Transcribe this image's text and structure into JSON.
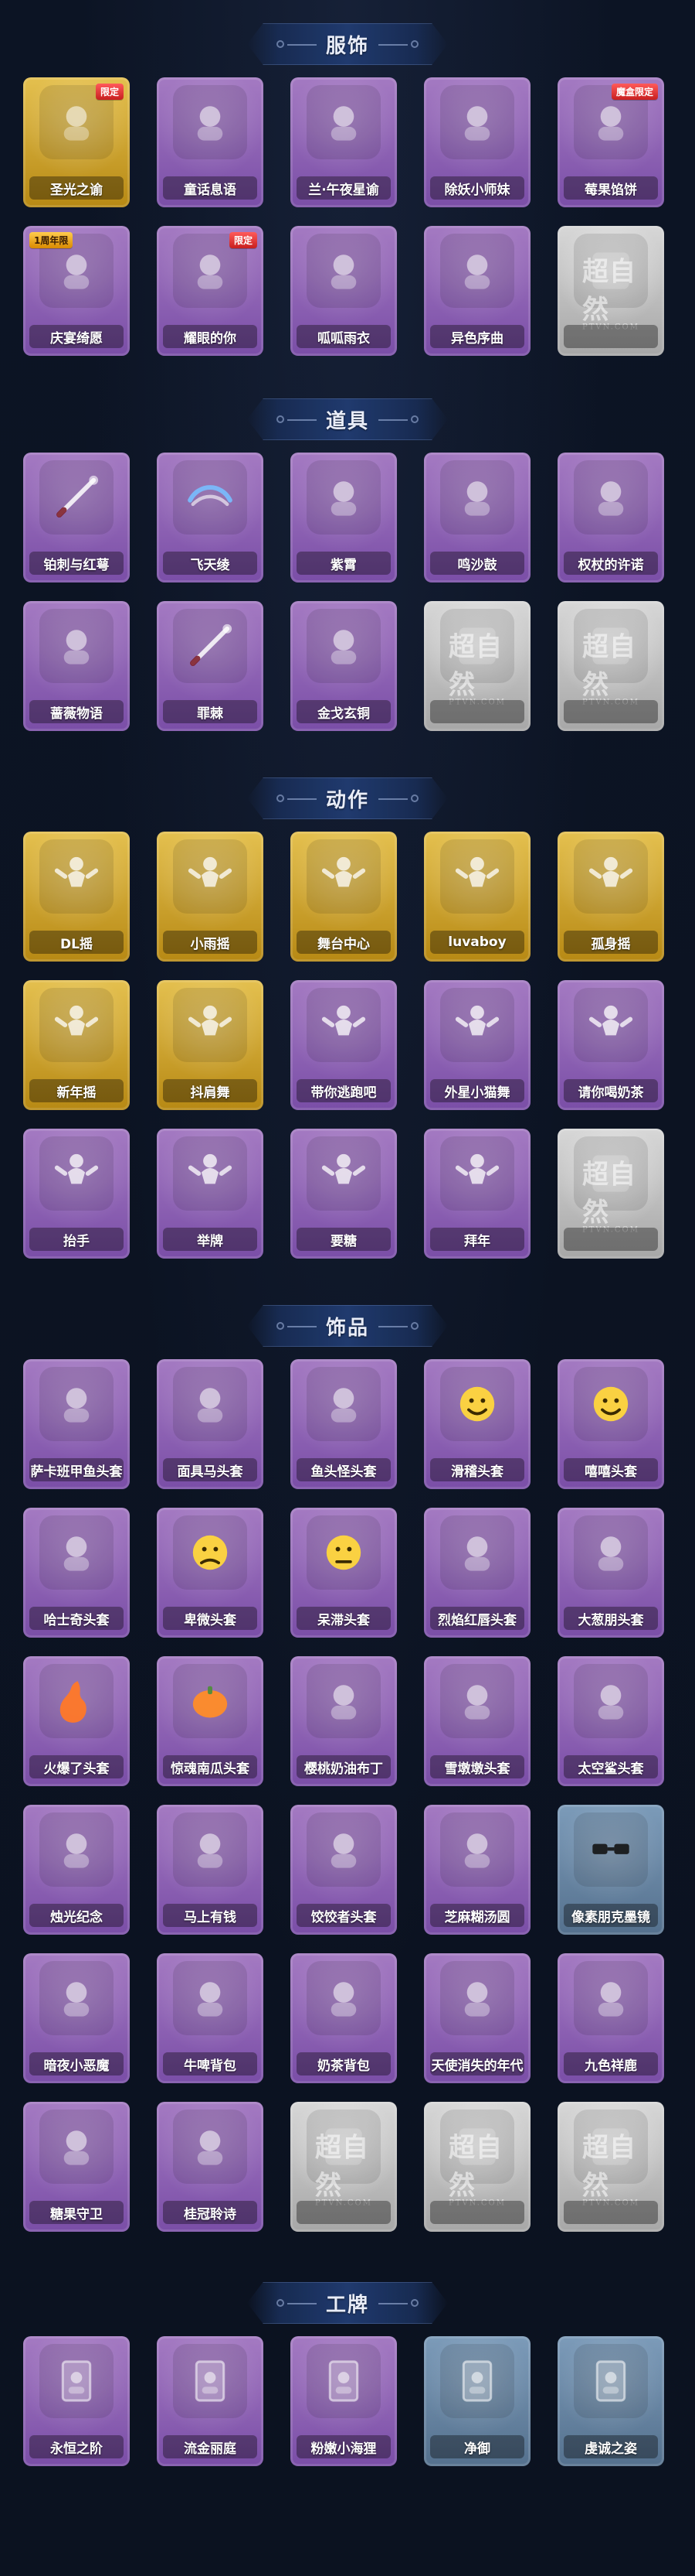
{
  "sections": [
    {
      "title": "服饰",
      "items": [
        {
          "label": "圣光之谕",
          "theme": "gold",
          "badge": "限定",
          "icon": "character-portrait-icon"
        },
        {
          "label": "童话息语",
          "theme": "purple",
          "badge": "",
          "icon": "character-portrait-icon"
        },
        {
          "label": "兰·午夜星谕",
          "theme": "purple",
          "badge": "",
          "icon": "character-portrait-icon"
        },
        {
          "label": "除妖小师妹",
          "theme": "purple",
          "badge": "",
          "icon": "character-portrait-icon"
        },
        {
          "label": "莓果馅饼",
          "theme": "purple",
          "badge": "魔盒限定",
          "icon": "character-portrait-icon"
        },
        {
          "label": "庆宴绮愿",
          "theme": "purple",
          "badge": "1周年限",
          "icon": "character-portrait-icon"
        },
        {
          "label": "耀眼的你",
          "theme": "purple",
          "badge": "限定",
          "icon": "character-portrait-icon"
        },
        {
          "label": "呱呱雨衣",
          "theme": "purple",
          "badge": "",
          "icon": "character-portrait-icon"
        },
        {
          "label": "异色序曲",
          "theme": "purple",
          "badge": "",
          "icon": "character-portrait-icon"
        },
        {
          "label": "",
          "theme": "silver",
          "badge": "",
          "icon": "watermark-icon",
          "watermark": "超自然",
          "watermark_sub": "PTVN.COM"
        }
      ]
    },
    {
      "title": "道具",
      "items": [
        {
          "label": "铂刺与红萼",
          "theme": "purple",
          "badge": "",
          "icon": "sword-icon"
        },
        {
          "label": "飞天绫",
          "theme": "purple",
          "badge": "",
          "icon": "ribbon-icon"
        },
        {
          "label": "紫霄",
          "theme": "purple",
          "badge": "",
          "icon": "wand-icon"
        },
        {
          "label": "鸣沙鼓",
          "theme": "purple",
          "badge": "",
          "icon": "drum-icon"
        },
        {
          "label": "权杖的许诺",
          "theme": "purple",
          "badge": "",
          "icon": "scepter-icon"
        },
        {
          "label": "蔷薇物语",
          "theme": "purple",
          "badge": "",
          "icon": "kit-icon"
        },
        {
          "label": "罪棘",
          "theme": "purple",
          "badge": "",
          "icon": "spear-icon"
        },
        {
          "label": "金戈玄铜",
          "theme": "purple",
          "badge": "",
          "icon": "artifact-icon"
        },
        {
          "label": "",
          "theme": "silver",
          "badge": "",
          "icon": "watermark-icon",
          "watermark": "超自然",
          "watermark_sub": "PTVN.COM"
        },
        {
          "label": "",
          "theme": "silver",
          "badge": "",
          "icon": "watermark-icon",
          "watermark": "超自然",
          "watermark_sub": "PTVN.COM"
        }
      ]
    },
    {
      "title": "动作",
      "items": [
        {
          "label": "DL摇",
          "theme": "gold",
          "badge": "",
          "icon": "dance-icon"
        },
        {
          "label": "小雨摇",
          "theme": "gold",
          "badge": "",
          "icon": "dance-icon"
        },
        {
          "label": "舞台中心",
          "theme": "gold",
          "badge": "",
          "icon": "dance-icon"
        },
        {
          "label": "luvaboy",
          "theme": "gold",
          "badge": "",
          "icon": "dance-icon"
        },
        {
          "label": "孤身摇",
          "theme": "gold",
          "badge": "",
          "icon": "dance-icon"
        },
        {
          "label": "新年摇",
          "theme": "gold",
          "badge": "",
          "icon": "dance-icon"
        },
        {
          "label": "抖肩舞",
          "theme": "gold",
          "badge": "",
          "icon": "dance-icon"
        },
        {
          "label": "带你逃跑吧",
          "theme": "purple",
          "badge": "",
          "icon": "dance-icon"
        },
        {
          "label": "外星小猫舞",
          "theme": "purple",
          "badge": "",
          "icon": "dance-icon"
        },
        {
          "label": "请你喝奶茶",
          "theme": "purple",
          "badge": "",
          "icon": "dance-icon"
        },
        {
          "label": "抬手",
          "theme": "purple",
          "badge": "",
          "icon": "dance-icon"
        },
        {
          "label": "举牌",
          "theme": "purple",
          "badge": "",
          "icon": "dance-icon"
        },
        {
          "label": "要糖",
          "theme": "purple",
          "badge": "",
          "icon": "dance-icon"
        },
        {
          "label": "拜年",
          "theme": "purple",
          "badge": "",
          "icon": "dance-icon"
        },
        {
          "label": "",
          "theme": "silver",
          "badge": "",
          "icon": "watermark-icon",
          "watermark": "超自然",
          "watermark_sub": "PTVN.COM"
        }
      ]
    },
    {
      "title": "饰品",
      "items": [
        {
          "label": "萨卡班甲鱼头套",
          "theme": "purple",
          "badge": "",
          "icon": "mask-icon"
        },
        {
          "label": "面具马头套",
          "theme": "purple",
          "badge": "",
          "icon": "mask-icon"
        },
        {
          "label": "鱼头怪头套",
          "theme": "purple",
          "badge": "",
          "icon": "mask-icon"
        },
        {
          "label": "滑稽头套",
          "theme": "purple",
          "badge": "",
          "icon": "smile-icon"
        },
        {
          "label": "嘻嘻头套",
          "theme": "purple",
          "badge": "",
          "icon": "grin-icon"
        },
        {
          "label": "哈士奇头套",
          "theme": "purple",
          "badge": "",
          "icon": "dog-icon"
        },
        {
          "label": "卑微头套",
          "theme": "purple",
          "badge": "",
          "icon": "sad-icon"
        },
        {
          "label": "呆滞头套",
          "theme": "purple",
          "badge": "",
          "icon": "blank-face-icon"
        },
        {
          "label": "烈焰红唇头套",
          "theme": "purple",
          "badge": "",
          "icon": "character-mask-icon"
        },
        {
          "label": "大葱朋头套",
          "theme": "purple",
          "badge": "",
          "icon": "leaf-icon"
        },
        {
          "label": "火爆了头套",
          "theme": "purple",
          "badge": "",
          "icon": "fire-icon"
        },
        {
          "label": "惊魂南瓜头套",
          "theme": "purple",
          "badge": "",
          "icon": "pumpkin-icon"
        },
        {
          "label": "樱桃奶油布丁",
          "theme": "purple",
          "badge": "",
          "icon": "pudding-icon"
        },
        {
          "label": "雪墩墩头套",
          "theme": "purple",
          "badge": "",
          "icon": "snow-icon"
        },
        {
          "label": "太空鲨头套",
          "theme": "purple",
          "badge": "",
          "icon": "shark-icon"
        },
        {
          "label": "烛光纪念",
          "theme": "purple",
          "badge": "",
          "icon": "candle-icon"
        },
        {
          "label": "马上有钱",
          "theme": "purple",
          "badge": "",
          "icon": "horse-icon"
        },
        {
          "label": "饺饺者头套",
          "theme": "purple",
          "badge": "",
          "icon": "dumpling-icon"
        },
        {
          "label": "芝麻糊汤圆",
          "theme": "purple",
          "badge": "",
          "icon": "tangyuan-icon"
        },
        {
          "label": "像素朋克墨镜",
          "theme": "blue",
          "badge": "",
          "icon": "glasses-icon"
        },
        {
          "label": "暗夜小恶魔",
          "theme": "purple",
          "badge": "",
          "icon": "devil-icon"
        },
        {
          "label": "牛啤背包",
          "theme": "purple",
          "badge": "",
          "icon": "backpack-icon"
        },
        {
          "label": "奶茶背包",
          "theme": "purple",
          "badge": "",
          "icon": "bag-icon"
        },
        {
          "label": "天使消失的年代",
          "theme": "purple",
          "badge": "",
          "icon": "angel-icon"
        },
        {
          "label": "九色祥鹿",
          "theme": "purple",
          "badge": "",
          "icon": "deer-icon"
        },
        {
          "label": "糖果守卫",
          "theme": "purple",
          "badge": "",
          "icon": "doll-icon"
        },
        {
          "label": "桂冠聆诗",
          "theme": "purple",
          "badge": "",
          "icon": "doll-icon"
        },
        {
          "label": "",
          "theme": "silver",
          "badge": "",
          "icon": "watermark-icon",
          "watermark": "超自然",
          "watermark_sub": "PTVN.COM"
        },
        {
          "label": "",
          "theme": "silver",
          "badge": "",
          "icon": "watermark-icon",
          "watermark": "超自然",
          "watermark_sub": "PTVN.COM"
        },
        {
          "label": "",
          "theme": "silver",
          "badge": "",
          "icon": "watermark-icon",
          "watermark": "超自然",
          "watermark_sub": "PTVN.COM"
        }
      ]
    },
    {
      "title": "工牌",
      "items": [
        {
          "label": "永恒之阶",
          "theme": "purple",
          "badge": "",
          "icon": "badge-frame-icon"
        },
        {
          "label": "流金丽庭",
          "theme": "purple",
          "badge": "",
          "icon": "badge-frame-icon"
        },
        {
          "label": "粉嫩小海狸",
          "theme": "purple",
          "badge": "",
          "icon": "badge-frame-icon"
        },
        {
          "label": "净御",
          "theme": "blue",
          "badge": "",
          "icon": "badge-frame-icon"
        },
        {
          "label": "虔诚之姿",
          "theme": "blue",
          "badge": "",
          "icon": "badge-frame-icon"
        }
      ]
    }
  ],
  "colors": {
    "background": "#0b1220",
    "purple_card": "#8b5bb2",
    "gold_card": "#cfa12a",
    "silver_card": "#bdbdbd",
    "blue_card": "#6d8aa8",
    "badge_red": "#d62b2b"
  }
}
